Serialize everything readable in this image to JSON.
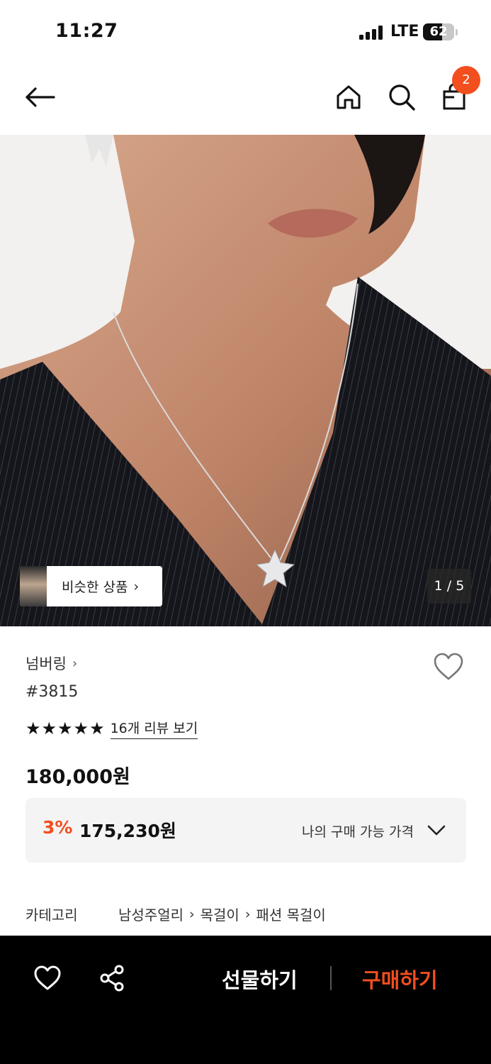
{
  "status_bar": {
    "time": "11:27",
    "network": "LTE",
    "battery": "62",
    "battery_level": 0.62
  },
  "nav": {
    "cart_count": "2",
    "icons": [
      "back-arrow-icon",
      "home-icon",
      "search-icon",
      "shopping-bag-icon"
    ]
  },
  "hero": {
    "similar_label": "비슷한 상품",
    "page_counter": "1 / 5"
  },
  "product": {
    "brand": "넘버링",
    "name": "#3815",
    "rating": 5,
    "review_link": "16개 리뷰 보기",
    "price": "180,000원",
    "discount_rate": "3%",
    "discounted_price": "175,230원",
    "my_price_label": "나의 구매 가능 가격"
  },
  "category": {
    "label": "카테고리",
    "path": [
      "남성주얼리",
      "목걸이",
      "패션 목걸이"
    ]
  },
  "bottom_bar": {
    "gift_label": "선물하기",
    "buy_label": "구매하기"
  },
  "colors": {
    "accent": "#f24e1e",
    "bottom_bar_bg": "#000000"
  }
}
